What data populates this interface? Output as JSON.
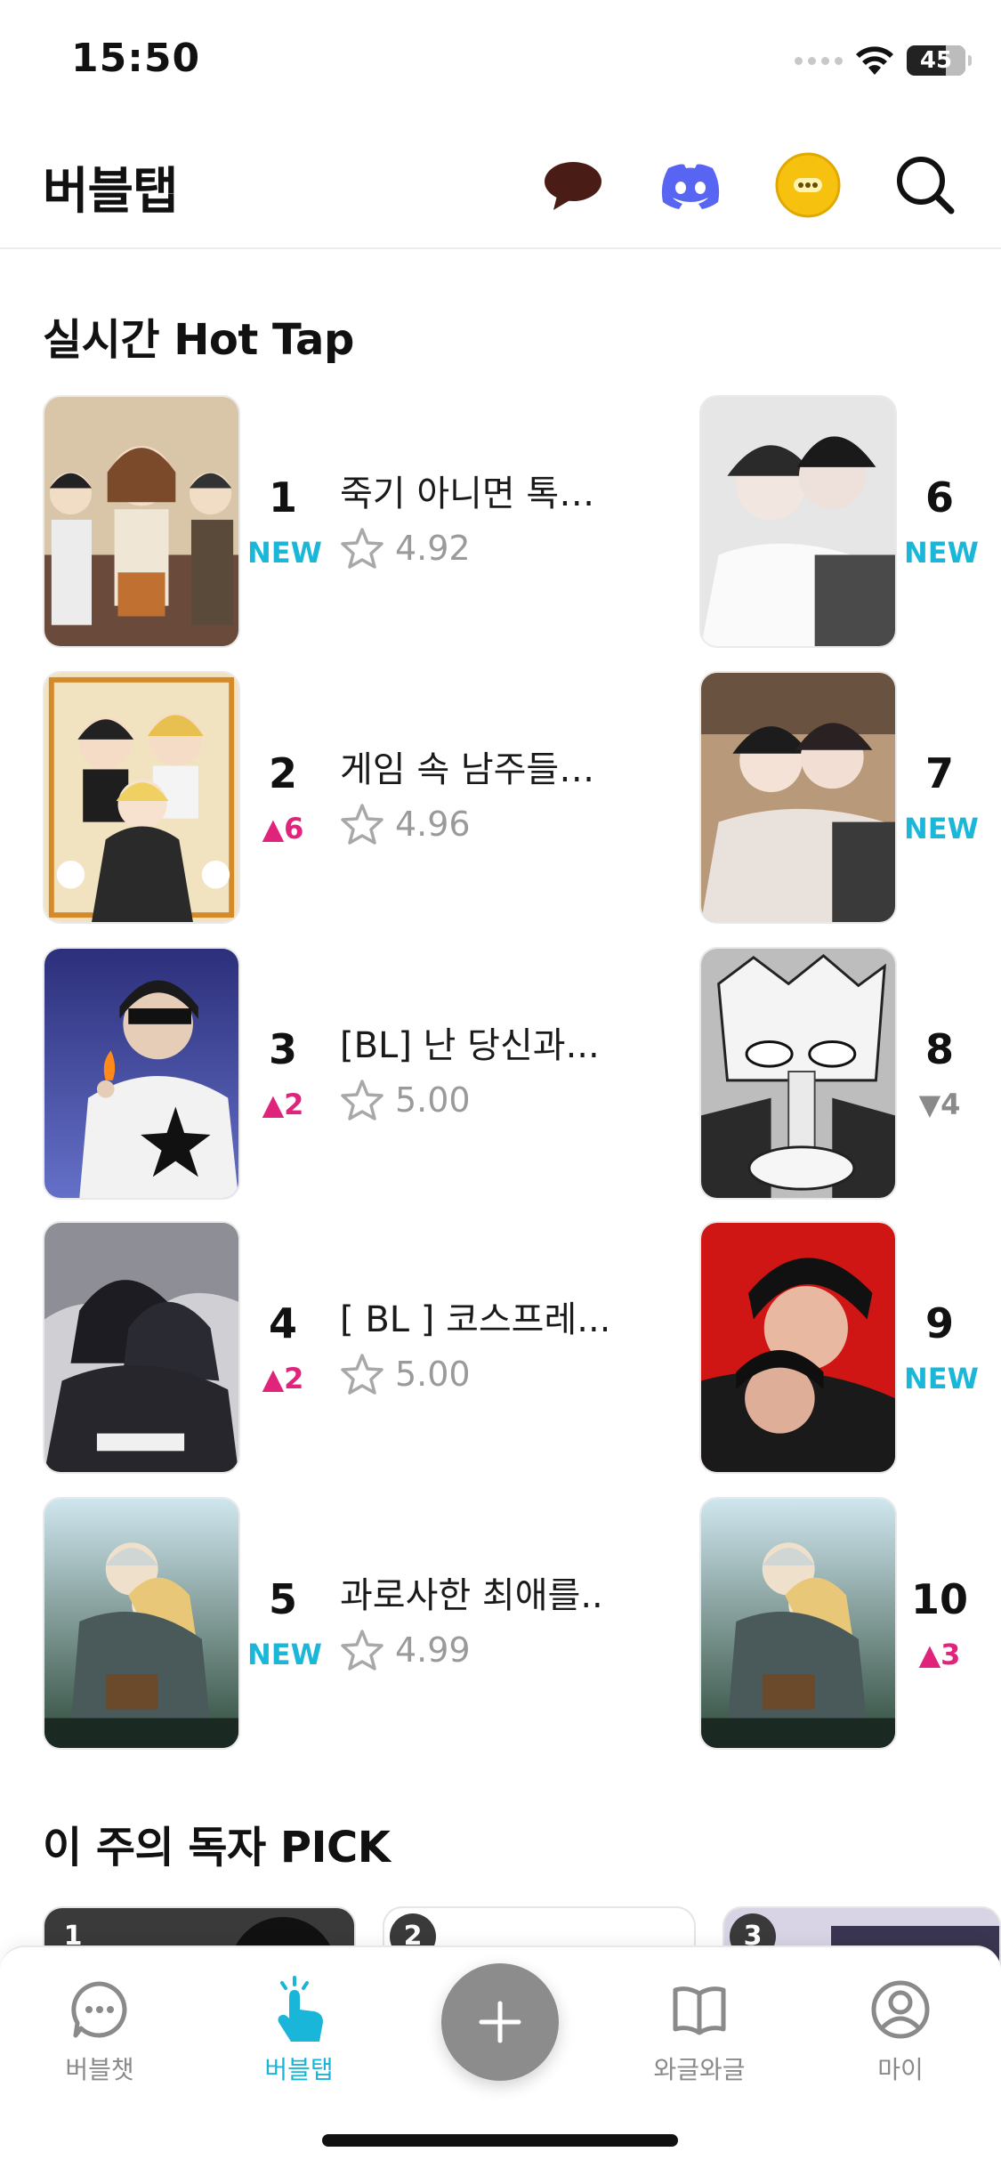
{
  "status_bar": {
    "time": "15:50",
    "battery": "45"
  },
  "header": {
    "title": "버블탭",
    "icons": [
      "chat-bubble-icon",
      "discord-icon",
      "emoji-face-icon",
      "search-icon"
    ]
  },
  "hot_tap": {
    "title": "실시간 Hot Tap",
    "items": [
      {
        "rank": "1",
        "change": "NEW",
        "change_type": "new",
        "title": "죽기 아니면 톡…",
        "rating": "4.92"
      },
      {
        "rank": "2",
        "change": "▲6",
        "change_type": "up",
        "title": "게임 속 남주들…",
        "rating": "4.96"
      },
      {
        "rank": "3",
        "change": "▲2",
        "change_type": "up",
        "title": "[BL] 난 당신과...",
        "rating": "5.00"
      },
      {
        "rank": "4",
        "change": "▲2",
        "change_type": "up",
        "title": "[ BL ] 코스프레...",
        "rating": "5.00"
      },
      {
        "rank": "5",
        "change": "NEW",
        "change_type": "new",
        "title": "과로사한 최애를...",
        "rating": "4.99"
      },
      {
        "rank": "6",
        "change": "NEW",
        "change_type": "new"
      },
      {
        "rank": "7",
        "change": "NEW",
        "change_type": "new"
      },
      {
        "rank": "8",
        "change": "▼4",
        "change_type": "down"
      },
      {
        "rank": "9",
        "change": "NEW",
        "change_type": "new"
      },
      {
        "rank": "10",
        "change": "▲3",
        "change_type": "up"
      }
    ]
  },
  "weekly_pick": {
    "title": "이 주의 독자 PICK",
    "badges": [
      "1",
      "2",
      "3"
    ]
  },
  "bottom_nav": {
    "items": [
      {
        "label": "버블챗",
        "icon": "chat-dots-icon",
        "active": false
      },
      {
        "label": "버블탭",
        "icon": "tap-hand-icon",
        "active": true
      },
      {
        "label": "와글와글",
        "icon": "book-icon",
        "active": false
      },
      {
        "label": "마이",
        "icon": "profile-icon",
        "active": false
      }
    ],
    "fab_icon": "plus-icon"
  },
  "colors": {
    "accent": "#19b6d9",
    "rank_up": "#e0237b",
    "rank_down": "#8a8a8a",
    "fab": "#8c8c8c"
  }
}
